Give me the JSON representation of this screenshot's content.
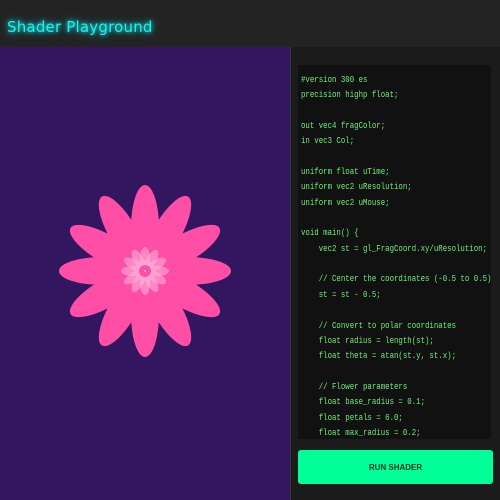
{
  "header": {
    "title": "Shader Playground"
  },
  "canvas": {
    "background_color": "#321760",
    "flower": {
      "petals": 12,
      "color": "#ff4ea6"
    }
  },
  "editor": {
    "code_color": "#6ef07a",
    "code": "#version 300 es\nprecision highp float;\n\nout vec4 fragColor;\nin vec3 Col;\n\nuniform float uTime;\nuniform vec2 uResolution;\nuniform vec2 uMouse;\n\nvoid main() {\n    vec2 st = gl_FragCoord.xy/uResolution;\n\n    // Center the coordinates (-0.5 to 0.5)\n    st = st - 0.5;\n\n    // Convert to polar coordinates\n    float radius = length(st);\n    float theta = atan(st.y, st.x);\n\n    // Flower parameters\n    float base_radius = 0.1;\n    float petals = 6.0;\n    float max_radius = 0.2;"
  },
  "actions": {
    "run_label": "RUN SHADER",
    "run_color": "#00ff99"
  }
}
